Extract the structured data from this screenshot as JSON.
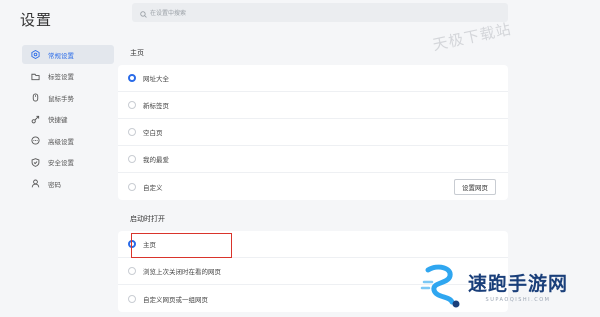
{
  "app": {
    "title": "设置"
  },
  "search": {
    "placeholder": "在设置中搜索"
  },
  "sidebar": {
    "items": [
      {
        "label": "常规设置",
        "icon": "hexagon-gear-icon",
        "active": true
      },
      {
        "label": "标签设置",
        "icon": "tab-icon"
      },
      {
        "label": "鼠标手势",
        "icon": "mouse-icon"
      },
      {
        "label": "快捷键",
        "icon": "link-arrow-icon"
      },
      {
        "label": "高级设置",
        "icon": "more-circle-icon"
      },
      {
        "label": "安全设置",
        "icon": "shield-icon"
      },
      {
        "label": "密码",
        "icon": "user-icon"
      }
    ]
  },
  "homepage": {
    "label": "主页",
    "options": [
      {
        "label": "网址大全",
        "checked": true
      },
      {
        "label": "新标签页",
        "checked": false
      },
      {
        "label": "空白页",
        "checked": false
      },
      {
        "label": "我的最爱",
        "checked": false
      },
      {
        "label": "自定义",
        "checked": false
      }
    ],
    "set_button": "设置网页"
  },
  "startup": {
    "label": "启动时打开",
    "options": [
      {
        "label": "主页",
        "checked": true
      },
      {
        "label": "浏览上次关闭时在看的网页",
        "checked": false
      },
      {
        "label": "自定义网页或一组网页",
        "checked": false
      }
    ]
  },
  "watermarks": {
    "top": "天极下载站",
    "brand_name": "速跑手游网",
    "brand_url": "SUPAOQISHI.COM"
  },
  "colors": {
    "accent": "#2a6be8",
    "highlight": "#d9342b"
  }
}
